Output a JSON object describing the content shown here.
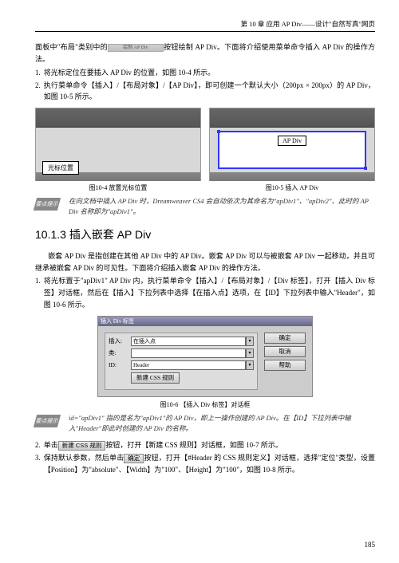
{
  "header": "第 10 章  应用 AP Div——设计\"自然写真\"网页",
  "para1a": "面板中\"布局\"类别中的",
  "btn1": "绘制 AP Div",
  "para1b": "按钮绘制 AP Div。下面将介绍使用菜单命令插入 AP Div 的操作方法。",
  "list1": {
    "i1": "将光标定位在要插入 AP Div 的位置，如图 10-4 所示。",
    "i2": "执行菜单命令【插入】/【布局对象】/【AP Div】，即可创建一个默认大小（200px × 200px）的 AP Div，如图 10-5 所示。"
  },
  "figcap1": "图10-4  放置光标位置",
  "figcap2": "图10-5  插入 AP Div",
  "cursorLabel": "光标位置",
  "apLabel": "AP Div",
  "tip1": "在向文档中插入 AP Div 时，Dreamweaver CS4 会自动依次为其命名为\"apDiv1\"、\"apDiv2\"、此时的 AP Div 名称即为\"apDiv1\"。",
  "tipLabel": "要点提示",
  "h2": "10.1.3  插入嵌套 AP Div",
  "para2": "嵌套 AP Div 是指创建在其他 AP Div 中的 AP Div。嵌套 AP Div 可以与被嵌套 AP Div 一起移动，并且可继承被嵌套 AP Div 的可见性。下面将介绍插入嵌套 AP Div 的操作方法。",
  "list2": {
    "i1": "将光标置于\"apDiv1\" AP Div 内，执行菜单命令【插入】/【布局对象】/【Div 标签】，打开【插入 Div 标签】对话框，然后在【插入】下拉列表中选择【在插入点】选项，在【ID】下拉列表中输入\"Header\"，如图 10-6 所示。"
  },
  "dialog": {
    "title": "插入 Div 标签",
    "lbl1": "插入:",
    "val1": "在插入点",
    "lbl2": "类:",
    "val2": "",
    "lbl3": "ID:",
    "val3": "Header",
    "newcss": "新建 CSS 规则",
    "ok": "确定",
    "cancel": "取消",
    "help": "帮助"
  },
  "figcap3": "图10-6  【插入 Div 标签】对话框",
  "tip2": "id=\"apDiv1\" 指的是名为\"apDiv1\"的 AP Div，即上一操作创建的 AP Div。在【ID】下拉列表中输入\"Header\"即此时创建的 AP Div 的名称。",
  "list3": {
    "i2a": "单击",
    "btn2": "新建 CSS 规则",
    "i2b": "按钮，打开【新建 CSS 规则】对话框，如图 10-7 所示。",
    "i3a": "保持默认参数，然后单击",
    "btn3": "确定",
    "i3b": "按钮，打开【#Header 的 CSS 规则定义】对话框，选择\"定位\"类型，设置【Position】为\"absolute\"、【Width】为\"100\"、【Height】为\"100\"，如图 10-8 所示。"
  },
  "pgnum": "185"
}
